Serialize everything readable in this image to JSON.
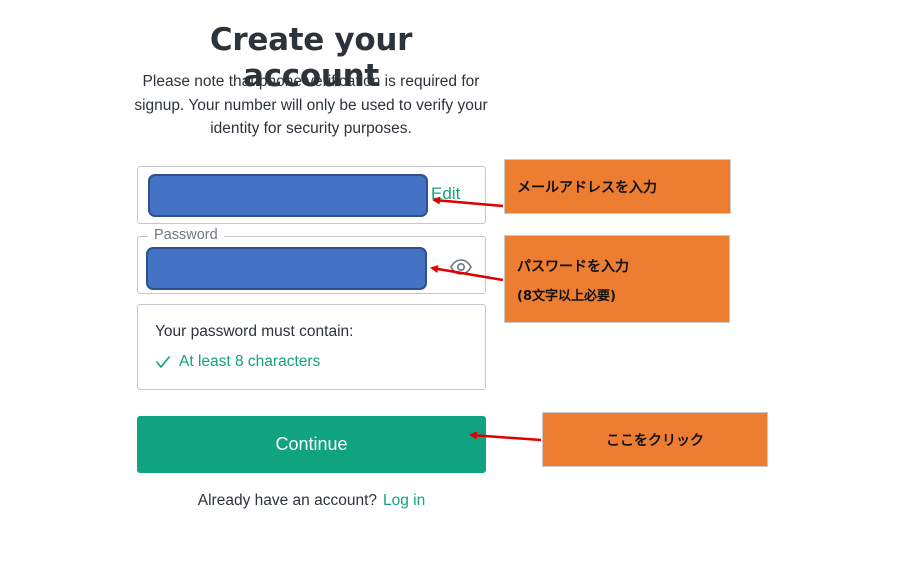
{
  "header": {
    "title": "Create your account",
    "subtitle": "Please note that phone verification is required for signup. Your number will only be used to verify your identity for security purposes."
  },
  "email": {
    "edit_label": "Edit"
  },
  "password": {
    "label": "Password",
    "toggle_icon": "eye-icon"
  },
  "requirements": {
    "title": "Your password must contain:",
    "items": [
      {
        "icon": "check-icon",
        "label": "At least 8 characters",
        "met": true
      }
    ]
  },
  "actions": {
    "continue_label": "Continue",
    "login_prompt": "Already have an account?",
    "login_link": "Log in"
  },
  "annotations": {
    "email_note": "メールアドレスを入力",
    "password_note_line1": "パスワードを入力",
    "password_note_line2": "(8文字以上必要)",
    "continue_note": "ここをクリック"
  },
  "colors": {
    "accent": "#10a37f",
    "text": "#2d333a",
    "field_border": "#c2c8d0",
    "mask_fill": "#4472c4",
    "note_fill": "#ed7d31",
    "arrow": "#e00000"
  }
}
